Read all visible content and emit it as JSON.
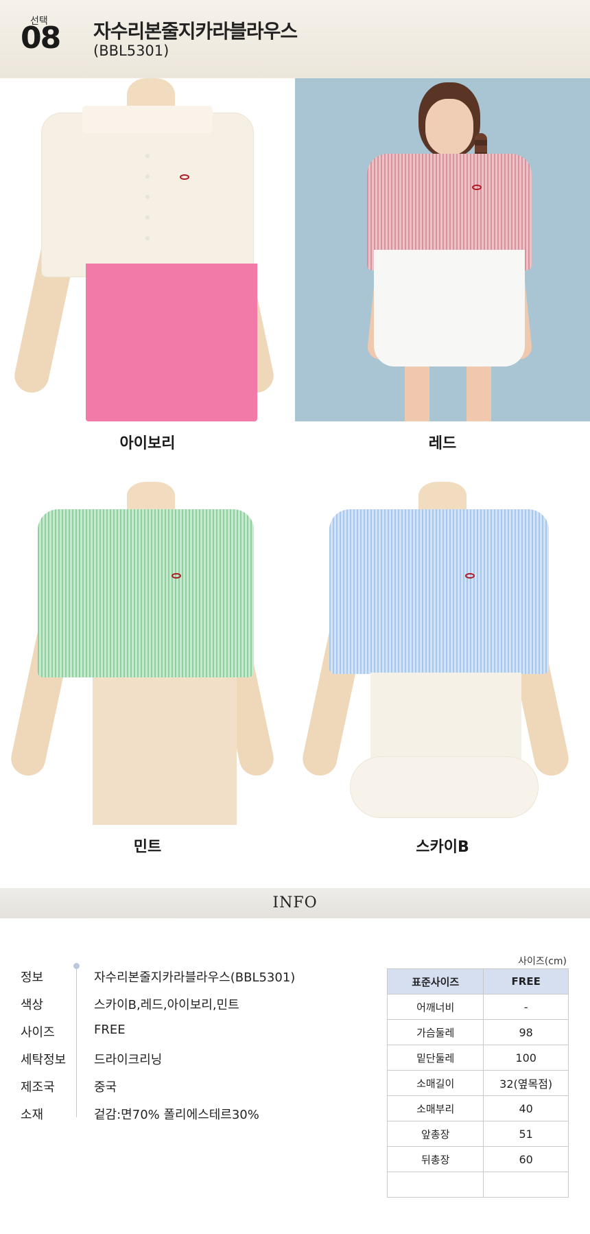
{
  "header": {
    "select_label": "선택",
    "select_number": "08",
    "product_name": "자수리본줄지카라블라우스",
    "product_code": "(BBL5301)"
  },
  "colors": [
    {
      "label": "아이보리",
      "shirt": "#f6efe4",
      "skirt": "#f27aa8"
    },
    {
      "label": "레드",
      "shirt": "#e9b4bb",
      "skirt": "#f7f7f5"
    },
    {
      "label": "민트",
      "shirt": "#bfe6c9",
      "skirt": "#f1dfc7"
    },
    {
      "label": "스카이B",
      "shirt": "#cfe1f6",
      "skirt": "#f6f1e6"
    }
  ],
  "info_banner": "INFO",
  "info": [
    {
      "key": "정보",
      "value": "자수리본줄지카라블라우스(BBL5301)"
    },
    {
      "key": "색상",
      "value": "스카이B,레드,아이보리,민트"
    },
    {
      "key": "사이즈",
      "value": "FREE"
    },
    {
      "key": "세탁정보",
      "value": "드라이크리닝"
    },
    {
      "key": "제조국",
      "value": "중국"
    },
    {
      "key": "소재",
      "value": "겉감:면70% 폴리에스테르30%"
    }
  ],
  "size_table": {
    "unit": "사이즈(cm)",
    "headers": [
      "표준사이즈",
      "FREE"
    ],
    "rows": [
      {
        "name": "어깨너비",
        "value": "-"
      },
      {
        "name": "가슴둘레",
        "value": "98"
      },
      {
        "name": "밑단둘레",
        "value": "100"
      },
      {
        "name": "소매길이",
        "value": "32(옆목점)"
      },
      {
        "name": "소매부리",
        "value": "40"
      },
      {
        "name": "앞총장",
        "value": "51"
      },
      {
        "name": "뒤총장",
        "value": "60"
      },
      {
        "name": "",
        "value": ""
      }
    ]
  }
}
